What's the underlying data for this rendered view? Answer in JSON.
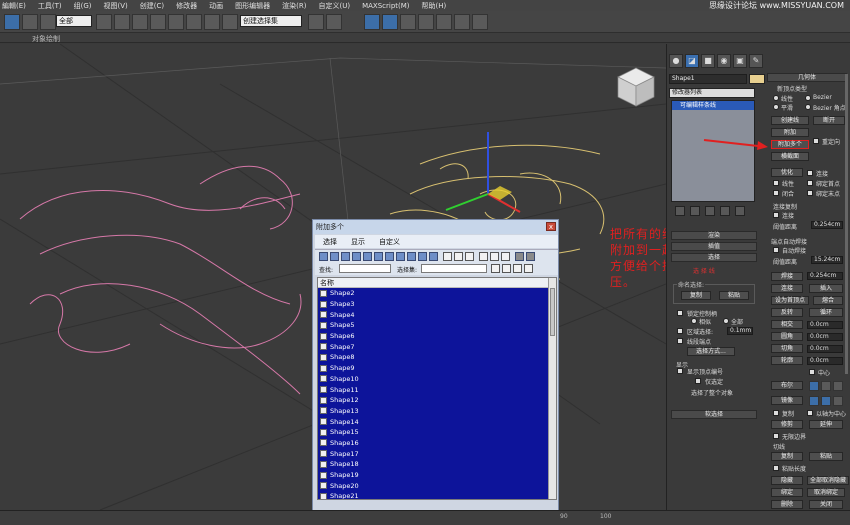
{
  "menubar": {
    "items": [
      "編輯(E)",
      "工具(T)",
      "组(G)",
      "视图(V)",
      "创建(C)",
      "修改器",
      "动画",
      "图形编辑器",
      "渲染(R)",
      "自定义(U)",
      "MAXScript(M)",
      "帮助(H)"
    ],
    "watermark": "思缘设计论坛 www.MISSYUAN.COM"
  },
  "toolbar": {
    "selection_filter": "全部",
    "named_selection": "创建选择集"
  },
  "ribbon": {
    "label": "对象绘制"
  },
  "viewport": {
    "annotation": "把所有的线都附加到一起，方便给个挤压。",
    "axis_labels": [
      "Z",
      "X",
      "Y"
    ]
  },
  "command_panel": {
    "object_name": "Shape1",
    "modifier_list": "修改器列表",
    "stack_item": "可编辑样条线",
    "rollout_render": "渲染",
    "rollout_interp": "插值",
    "rollout_select": "选择",
    "red_label": "选 择 线",
    "section_selection": "命名选择:",
    "copy": "复制",
    "paste": "粘贴",
    "lock_handles": "锁定控制柄",
    "similar": "相似",
    "all": "全部",
    "area_select": "区域选择:",
    "area_value": "0.1mm",
    "segment_end": "线段端点",
    "select_by": "选择方式...",
    "display": "显示",
    "show_vertex_num": "显示顶点编号",
    "only_selected": "仅选定",
    "selected_summary": "选择了整个对象",
    "soft_select": "软选择",
    "geometry": "几何体",
    "new_vertex_type": "新顶点类型",
    "linear": "线性",
    "bezier": "Bezier",
    "smooth": "平滑",
    "bezier_corner": "Bezier 角点",
    "create_line": "创建线",
    "break": "断开",
    "attach": "附加",
    "attach_mult": "附加多个",
    "reorient": "重定向",
    "cross_section": "横截面",
    "optimize": "优化",
    "connect": "连接",
    "linear2": "线性",
    "bind_first": "绑定首点",
    "closed": "闭合",
    "bind_last": "绑定末点",
    "connect_copy": "连接复制",
    "connect_copy_chk": "连接",
    "threshold": "阈值距离",
    "threshold_val": "0.254cm",
    "endpoint_weld": "端点自动焊接",
    "auto_weld": "自动焊接",
    "threshold2_val": "15.24cm",
    "weld": "焊接",
    "connect2": "连接",
    "insert": "插入",
    "set_first": "设为首顶点",
    "fuse": "熔合",
    "reverse": "反转",
    "cycle": "循环",
    "crossinsert": "相交",
    "fillet": "圆角",
    "chamfer": "切角",
    "outline": "轮廓",
    "val1": "0.254cm",
    "val2": "0.0cm",
    "val3": "0.0cm",
    "val4": "0.0cm",
    "center": "中心",
    "boolean": "布尔",
    "mirror": "镜像",
    "copy2": "复制",
    "about_pivot": "以轴为中心",
    "trim": "修剪",
    "extend": "延伸",
    "infinite": "无限边界",
    "tangent": "切线",
    "copy3": "复制",
    "paste2": "粘贴",
    "paste_len": "粘贴长度",
    "hide": "隐藏",
    "unhide_all": "全部取消隐藏",
    "bind": "绑定",
    "unbind": "取消绑定",
    "delete": "删除",
    "close": "关闭"
  },
  "dialog": {
    "title": "附加多个",
    "close": "x",
    "menu": [
      "选择",
      "显示",
      "自定义"
    ],
    "find_label": "查找:",
    "set_label": "选择集:",
    "column": "名称",
    "rows": [
      "Shape2",
      "Shape3",
      "Shape4",
      "Shape5",
      "Shape6",
      "Shape7",
      "Shape8",
      "Shape9",
      "Shape10",
      "Shape11",
      "Shape12",
      "Shape13",
      "Shape14",
      "Shape15",
      "Shape16",
      "Shape17",
      "Shape18",
      "Shape19",
      "Shape20",
      "Shape21"
    ],
    "attach_btn": "附加",
    "cancel_btn": "取消"
  },
  "statusbar": {
    "frame": "90",
    "frame2": "100"
  }
}
